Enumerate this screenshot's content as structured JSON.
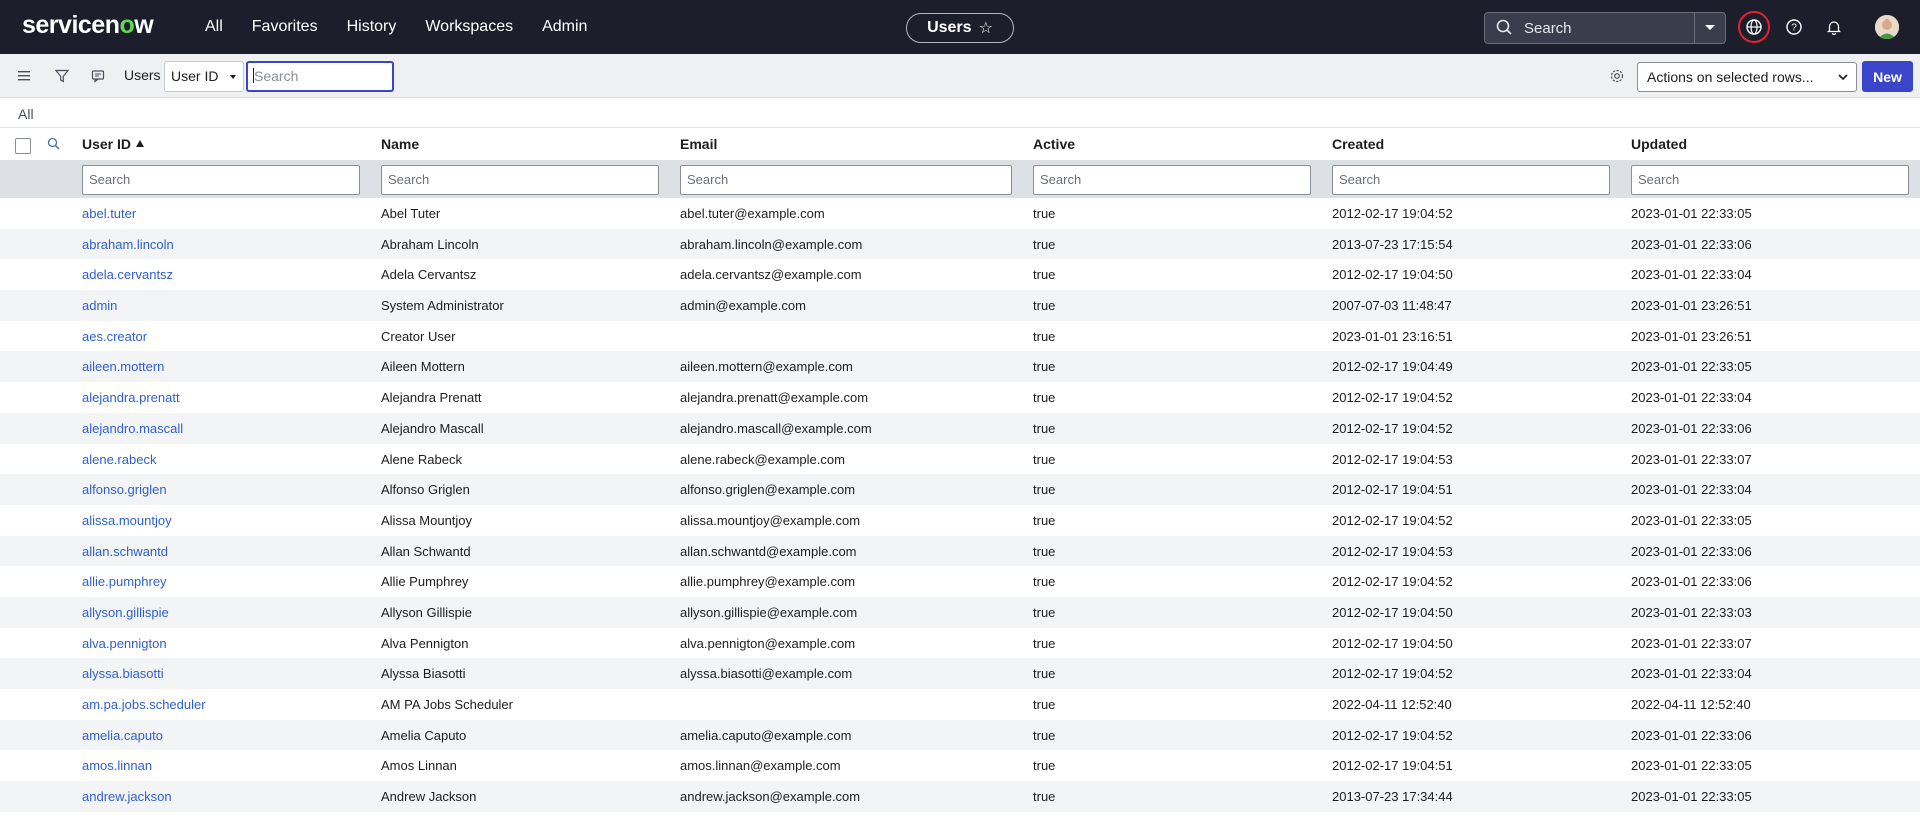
{
  "brand": {
    "logo_text_a": "servicen",
    "logo_text_o": "o",
    "logo_text_b": "w"
  },
  "nav": {
    "menu": [
      "All",
      "Favorites",
      "History",
      "Workspaces",
      "Admin"
    ],
    "context_title": "Users",
    "search_placeholder": "Search"
  },
  "colors": {
    "nav_bg": "#1c1f2b",
    "accent": "#3b45c9",
    "link": "#2f5fcf",
    "highlight_ring": "#e4222f"
  },
  "toolbar": {
    "title": "Users",
    "field_select": "User ID",
    "search_placeholder": "Search",
    "actions_label": "Actions on selected rows...",
    "new_label": "New"
  },
  "breadcrumb": "All",
  "table": {
    "columns": [
      "User ID",
      "Name",
      "Email",
      "Active",
      "Created",
      "Updated"
    ],
    "sorted_column": "User ID",
    "filter_placeholder": "Search",
    "rows": [
      [
        "abel.tuter",
        "Abel Tuter",
        "abel.tuter@example.com",
        "true",
        "2012-02-17 19:04:52",
        "2023-01-01 22:33:05"
      ],
      [
        "abraham.lincoln",
        "Abraham Lincoln",
        "abraham.lincoln@example.com",
        "true",
        "2013-07-23 17:15:54",
        "2023-01-01 22:33:06"
      ],
      [
        "adela.cervantsz",
        "Adela Cervantsz",
        "adela.cervantsz@example.com",
        "true",
        "2012-02-17 19:04:50",
        "2023-01-01 22:33:04"
      ],
      [
        "admin",
        "System Administrator",
        "admin@example.com",
        "true",
        "2007-07-03 11:48:47",
        "2023-01-01 23:26:51"
      ],
      [
        "aes.creator",
        "Creator User",
        "",
        "true",
        "2023-01-01 23:16:51",
        "2023-01-01 23:26:51"
      ],
      [
        "aileen.mottern",
        "Aileen Mottern",
        "aileen.mottern@example.com",
        "true",
        "2012-02-17 19:04:49",
        "2023-01-01 22:33:05"
      ],
      [
        "alejandra.prenatt",
        "Alejandra Prenatt",
        "alejandra.prenatt@example.com",
        "true",
        "2012-02-17 19:04:52",
        "2023-01-01 22:33:04"
      ],
      [
        "alejandro.mascall",
        "Alejandro Mascall",
        "alejandro.mascall@example.com",
        "true",
        "2012-02-17 19:04:52",
        "2023-01-01 22:33:06"
      ],
      [
        "alene.rabeck",
        "Alene Rabeck",
        "alene.rabeck@example.com",
        "true",
        "2012-02-17 19:04:53",
        "2023-01-01 22:33:07"
      ],
      [
        "alfonso.griglen",
        "Alfonso Griglen",
        "alfonso.griglen@example.com",
        "true",
        "2012-02-17 19:04:51",
        "2023-01-01 22:33:04"
      ],
      [
        "alissa.mountjoy",
        "Alissa Mountjoy",
        "alissa.mountjoy@example.com",
        "true",
        "2012-02-17 19:04:52",
        "2023-01-01 22:33:05"
      ],
      [
        "allan.schwantd",
        "Allan Schwantd",
        "allan.schwantd@example.com",
        "true",
        "2012-02-17 19:04:53",
        "2023-01-01 22:33:06"
      ],
      [
        "allie.pumphrey",
        "Allie Pumphrey",
        "allie.pumphrey@example.com",
        "true",
        "2012-02-17 19:04:52",
        "2023-01-01 22:33:06"
      ],
      [
        "allyson.gillispie",
        "Allyson Gillispie",
        "allyson.gillispie@example.com",
        "true",
        "2012-02-17 19:04:50",
        "2023-01-01 22:33:03"
      ],
      [
        "alva.pennigton",
        "Alva Pennigton",
        "alva.pennigton@example.com",
        "true",
        "2012-02-17 19:04:50",
        "2023-01-01 22:33:07"
      ],
      [
        "alyssa.biasotti",
        "Alyssa Biasotti",
        "alyssa.biasotti@example.com",
        "true",
        "2012-02-17 19:04:52",
        "2023-01-01 22:33:04"
      ],
      [
        "am.pa.jobs.scheduler",
        "AM PA Jobs Scheduler",
        "",
        "true",
        "2022-04-11 12:52:40",
        "2022-04-11 12:52:40"
      ],
      [
        "amelia.caputo",
        "Amelia Caputo",
        "amelia.caputo@example.com",
        "true",
        "2012-02-17 19:04:52",
        "2023-01-01 22:33:06"
      ],
      [
        "amos.linnan",
        "Amos Linnan",
        "amos.linnan@example.com",
        "true",
        "2012-02-17 19:04:51",
        "2023-01-01 22:33:05"
      ],
      [
        "andrew.jackson",
        "Andrew Jackson",
        "andrew.jackson@example.com",
        "true",
        "2013-07-23 17:34:44",
        "2023-01-01 22:33:05"
      ]
    ]
  }
}
